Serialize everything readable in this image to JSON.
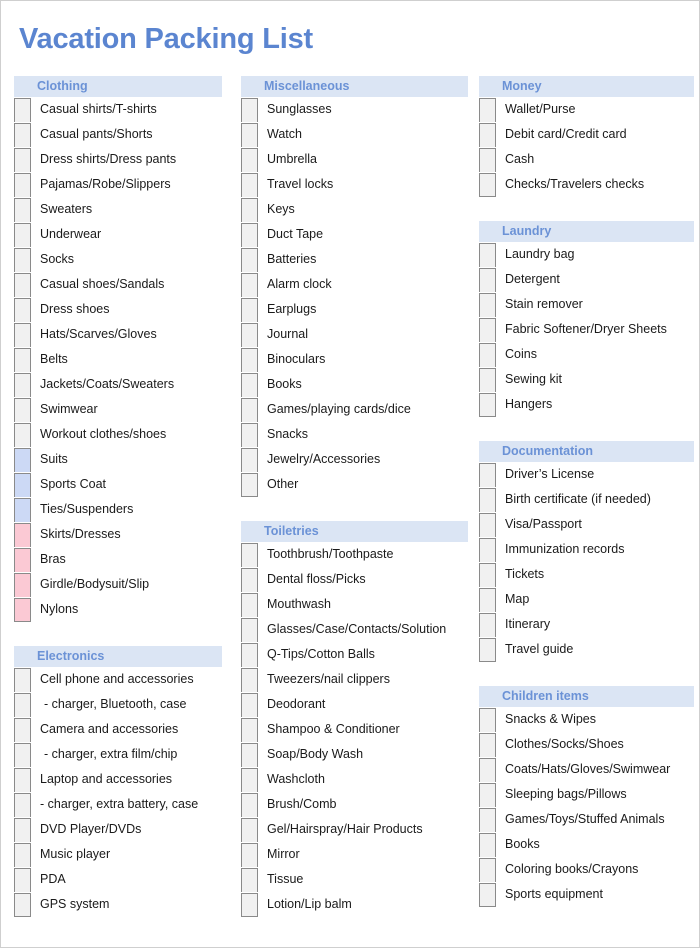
{
  "title": "Vacation Packing List",
  "colors": {
    "title": "#5b85d0",
    "header_bg": "#dbe5f4",
    "header_text": "#6b92d6",
    "checkbox_default": "#f1f1f1",
    "checkbox_blue": "#ccd9f5",
    "checkbox_pink": "#fbc9d4"
  },
  "columns": [
    {
      "sections": [
        {
          "header": "Clothing",
          "items": [
            {
              "label": "Casual shirts/T-shirts",
              "checkbox": "default",
              "indent": false
            },
            {
              "label": "Casual pants/Shorts",
              "checkbox": "default",
              "indent": false
            },
            {
              "label": "Dress shirts/Dress pants",
              "checkbox": "default",
              "indent": false
            },
            {
              "label": "Pajamas/Robe/Slippers",
              "checkbox": "default",
              "indent": false
            },
            {
              "label": "Sweaters",
              "checkbox": "default",
              "indent": false
            },
            {
              "label": "Underwear",
              "checkbox": "default",
              "indent": false
            },
            {
              "label": "Socks",
              "checkbox": "default",
              "indent": false
            },
            {
              "label": "Casual shoes/Sandals",
              "checkbox": "default",
              "indent": false
            },
            {
              "label": "Dress shoes",
              "checkbox": "default",
              "indent": false
            },
            {
              "label": "Hats/Scarves/Gloves",
              "checkbox": "default",
              "indent": false
            },
            {
              "label": "Belts",
              "checkbox": "default",
              "indent": false
            },
            {
              "label": "Jackets/Coats/Sweaters",
              "checkbox": "default",
              "indent": false
            },
            {
              "label": "Swimwear",
              "checkbox": "default",
              "indent": false
            },
            {
              "label": "Workout clothes/shoes",
              "checkbox": "default",
              "indent": false
            },
            {
              "label": "Suits",
              "checkbox": "blue",
              "indent": false
            },
            {
              "label": "Sports Coat",
              "checkbox": "blue",
              "indent": false
            },
            {
              "label": "Ties/Suspenders",
              "checkbox": "blue",
              "indent": false
            },
            {
              "label": "Skirts/Dresses",
              "checkbox": "pink",
              "indent": false
            },
            {
              "label": "Bras",
              "checkbox": "pink",
              "indent": false
            },
            {
              "label": "Girdle/Bodysuit/Slip",
              "checkbox": "pink",
              "indent": false
            },
            {
              "label": "Nylons",
              "checkbox": "pink",
              "indent": false
            }
          ]
        },
        {
          "header": "Electronics",
          "items": [
            {
              "label": "Cell phone and accessories",
              "checkbox": "default",
              "indent": false
            },
            {
              "label": "- charger, Bluetooth, case",
              "checkbox": "default",
              "indent": true
            },
            {
              "label": "Camera and accessories",
              "checkbox": "default",
              "indent": false
            },
            {
              "label": "- charger, extra film/chip",
              "checkbox": "default",
              "indent": true
            },
            {
              "label": "Laptop and accessories",
              "checkbox": "default",
              "indent": false
            },
            {
              "label": "- charger, extra battery, case",
              "checkbox": "default",
              "indent": false
            },
            {
              "label": "DVD Player/DVDs",
              "checkbox": "default",
              "indent": false
            },
            {
              "label": "Music player",
              "checkbox": "default",
              "indent": false
            },
            {
              "label": "PDA",
              "checkbox": "default",
              "indent": false
            },
            {
              "label": "GPS system",
              "checkbox": "default",
              "indent": false
            }
          ]
        }
      ]
    },
    {
      "sections": [
        {
          "header": "Miscellaneous",
          "items": [
            {
              "label": "Sunglasses",
              "checkbox": "default",
              "indent": false
            },
            {
              "label": "Watch",
              "checkbox": "default",
              "indent": false
            },
            {
              "label": "Umbrella",
              "checkbox": "default",
              "indent": false
            },
            {
              "label": "Travel locks",
              "checkbox": "default",
              "indent": false
            },
            {
              "label": "Keys",
              "checkbox": "default",
              "indent": false
            },
            {
              "label": "Duct Tape",
              "checkbox": "default",
              "indent": false
            },
            {
              "label": "Batteries",
              "checkbox": "default",
              "indent": false
            },
            {
              "label": "Alarm clock",
              "checkbox": "default",
              "indent": false
            },
            {
              "label": "Earplugs",
              "checkbox": "default",
              "indent": false
            },
            {
              "label": "Journal",
              "checkbox": "default",
              "indent": false
            },
            {
              "label": "Binoculars",
              "checkbox": "default",
              "indent": false
            },
            {
              "label": "Books",
              "checkbox": "default",
              "indent": false
            },
            {
              "label": "Games/playing cards/dice",
              "checkbox": "default",
              "indent": false
            },
            {
              "label": "Snacks",
              "checkbox": "default",
              "indent": false
            },
            {
              "label": "Jewelry/Accessories",
              "checkbox": "default",
              "indent": false
            },
            {
              "label": "Other",
              "checkbox": "default",
              "indent": false
            }
          ]
        },
        {
          "header": "Toiletries",
          "items": [
            {
              "label": "Toothbrush/Toothpaste",
              "checkbox": "default",
              "indent": false
            },
            {
              "label": "Dental floss/Picks",
              "checkbox": "default",
              "indent": false
            },
            {
              "label": "Mouthwash",
              "checkbox": "default",
              "indent": false
            },
            {
              "label": "Glasses/Case/Contacts/Solution",
              "checkbox": "default",
              "indent": false
            },
            {
              "label": "Q-Tips/Cotton Balls",
              "checkbox": "default",
              "indent": false
            },
            {
              "label": "Tweezers/nail clippers",
              "checkbox": "default",
              "indent": false
            },
            {
              "label": "Deodorant",
              "checkbox": "default",
              "indent": false
            },
            {
              "label": "Shampoo & Conditioner",
              "checkbox": "default",
              "indent": false
            },
            {
              "label": "Soap/Body Wash",
              "checkbox": "default",
              "indent": false
            },
            {
              "label": "Washcloth",
              "checkbox": "default",
              "indent": false
            },
            {
              "label": "Brush/Comb",
              "checkbox": "default",
              "indent": false
            },
            {
              "label": "Gel/Hairspray/Hair Products",
              "checkbox": "default",
              "indent": false
            },
            {
              "label": "Mirror",
              "checkbox": "default",
              "indent": false
            },
            {
              "label": "Tissue",
              "checkbox": "default",
              "indent": false
            },
            {
              "label": "Lotion/Lip balm",
              "checkbox": "default",
              "indent": false
            }
          ]
        }
      ]
    },
    {
      "sections": [
        {
          "header": "Money",
          "items": [
            {
              "label": "Wallet/Purse",
              "checkbox": "default",
              "indent": false
            },
            {
              "label": "Debit card/Credit card",
              "checkbox": "default",
              "indent": false
            },
            {
              "label": "Cash",
              "checkbox": "default",
              "indent": false
            },
            {
              "label": "Checks/Travelers checks",
              "checkbox": "default",
              "indent": false
            }
          ]
        },
        {
          "header": "Laundry",
          "items": [
            {
              "label": "Laundry bag",
              "checkbox": "default",
              "indent": false
            },
            {
              "label": "Detergent",
              "checkbox": "default",
              "indent": false
            },
            {
              "label": "Stain remover",
              "checkbox": "default",
              "indent": false
            },
            {
              "label": "Fabric Softener/Dryer Sheets",
              "checkbox": "default",
              "indent": false
            },
            {
              "label": "Coins",
              "checkbox": "default",
              "indent": false
            },
            {
              "label": "Sewing kit",
              "checkbox": "default",
              "indent": false
            },
            {
              "label": "Hangers",
              "checkbox": "default",
              "indent": false
            }
          ]
        },
        {
          "header": "Documentation",
          "items": [
            {
              "label": "Driver’s License",
              "checkbox": "default",
              "indent": false
            },
            {
              "label": "Birth certificate (if needed)",
              "checkbox": "default",
              "indent": false
            },
            {
              "label": "Visa/Passport",
              "checkbox": "default",
              "indent": false
            },
            {
              "label": "Immunization records",
              "checkbox": "default",
              "indent": false
            },
            {
              "label": "Tickets",
              "checkbox": "default",
              "indent": false
            },
            {
              "label": "Map",
              "checkbox": "default",
              "indent": false
            },
            {
              "label": "Itinerary",
              "checkbox": "default",
              "indent": false
            },
            {
              "label": "Travel guide",
              "checkbox": "default",
              "indent": false
            }
          ]
        },
        {
          "header": "Children items",
          "items": [
            {
              "label": "Snacks & Wipes",
              "checkbox": "default",
              "indent": false
            },
            {
              "label": "Clothes/Socks/Shoes",
              "checkbox": "default",
              "indent": false
            },
            {
              "label": "Coats/Hats/Gloves/Swimwear",
              "checkbox": "default",
              "indent": false
            },
            {
              "label": "Sleeping bags/Pillows",
              "checkbox": "default",
              "indent": false
            },
            {
              "label": "Games/Toys/Stuffed Animals",
              "checkbox": "default",
              "indent": false
            },
            {
              "label": "Books",
              "checkbox": "default",
              "indent": false
            },
            {
              "label": "Coloring books/Crayons",
              "checkbox": "default",
              "indent": false
            },
            {
              "label": "Sports equipment",
              "checkbox": "default",
              "indent": false
            }
          ]
        }
      ]
    }
  ]
}
